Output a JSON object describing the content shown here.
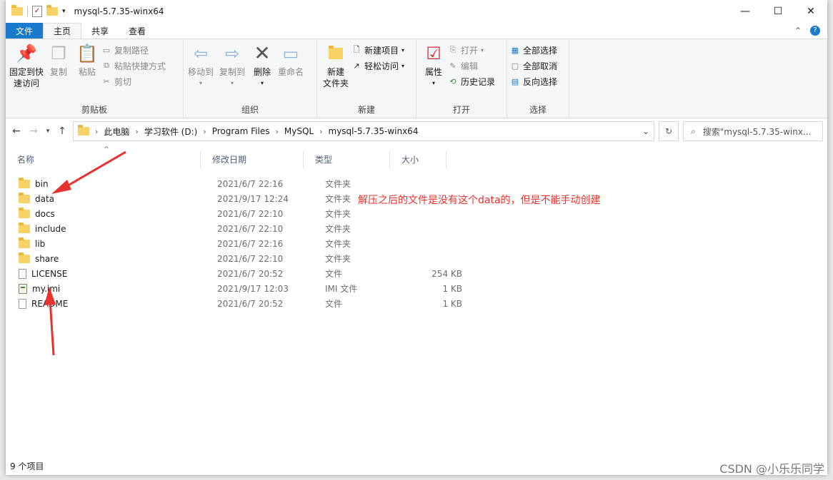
{
  "window": {
    "title": "mysql-5.7.35-winx64",
    "controls": {
      "minimize": "—",
      "maximize": "☐",
      "close": "✕"
    }
  },
  "ribbon_tabs": {
    "file": "文件",
    "home": "主页",
    "share": "共享",
    "view": "查看"
  },
  "ribbon": {
    "clipboard": {
      "label": "剪贴板",
      "pin_line1": "固定到快",
      "pin_line2": "速访问",
      "copy": "复制",
      "paste": "粘贴",
      "copy_path": "复制路径",
      "paste_shortcut": "粘贴快捷方式",
      "cut": "剪切"
    },
    "organize": {
      "label": "组织",
      "move_to": "移动到",
      "copy_to": "复制到",
      "delete": "删除",
      "rename": "重命名"
    },
    "new": {
      "label": "新建",
      "new_folder_line1": "新建",
      "new_folder_line2": "文件夹",
      "new_item": "新建项目",
      "easy_access": "轻松访问"
    },
    "open": {
      "label": "打开",
      "properties": "属性",
      "open": "打开",
      "edit": "编辑",
      "history": "历史记录"
    },
    "select": {
      "label": "选择",
      "select_all": "全部选择",
      "select_none": "全部取消",
      "invert": "反向选择"
    }
  },
  "address": {
    "crumbs": [
      "此电脑",
      "学习软件 (D:)",
      "Program Files",
      "MySQL",
      "mysql-5.7.35-winx64"
    ]
  },
  "search": {
    "placeholder": "搜索\"mysql-5.7.35-winx..."
  },
  "columns": {
    "name": "名称",
    "date": "修改日期",
    "type": "类型",
    "size": "大小"
  },
  "files": [
    {
      "name": "bin",
      "date": "2021/6/7 22:16",
      "type": "文件夹",
      "size": "",
      "icon": "folder"
    },
    {
      "name": "data",
      "date": "2021/9/17 12:24",
      "type": "文件夹",
      "size": "",
      "icon": "folder"
    },
    {
      "name": "docs",
      "date": "2021/6/7 22:10",
      "type": "文件夹",
      "size": "",
      "icon": "folder"
    },
    {
      "name": "include",
      "date": "2021/6/7 22:10",
      "type": "文件夹",
      "size": "",
      "icon": "folder"
    },
    {
      "name": "lib",
      "date": "2021/6/7 22:16",
      "type": "文件夹",
      "size": "",
      "icon": "folder"
    },
    {
      "name": "share",
      "date": "2021/6/7 22:10",
      "type": "文件夹",
      "size": "",
      "icon": "folder"
    },
    {
      "name": "LICENSE",
      "date": "2021/6/7 20:52",
      "type": "文件",
      "size": "254 KB",
      "icon": "file"
    },
    {
      "name": "my.imi",
      "date": "2021/9/17 12:03",
      "type": "IMI 文件",
      "size": "1 KB",
      "icon": "ini"
    },
    {
      "name": "README",
      "date": "2021/6/7 20:52",
      "type": "文件",
      "size": "1 KB",
      "icon": "file"
    }
  ],
  "annotation": "解压之后的文件是没有这个data的，但是不能手动创建",
  "status": "9 个项目",
  "watermark": "CSDN @小乐乐同学",
  "colors": {
    "accent": "#1979ca",
    "annotation": "#e8322d"
  }
}
